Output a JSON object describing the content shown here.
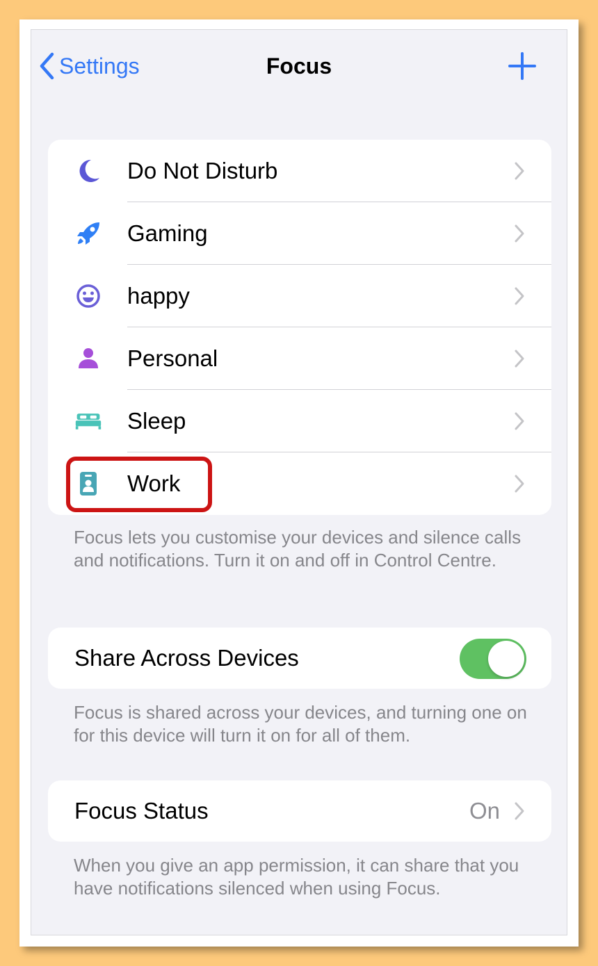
{
  "navbar": {
    "back_label": "Settings",
    "title": "Focus",
    "add_icon": "plus-icon"
  },
  "focus_modes": [
    {
      "label": "Do Not Disturb",
      "icon": "moon-icon",
      "color": "#5b57d6"
    },
    {
      "label": "Gaming",
      "icon": "rocket-icon",
      "color": "#2f7ff5"
    },
    {
      "label": "happy",
      "icon": "smiley-icon",
      "color": "#6a5fd7"
    },
    {
      "label": "Personal",
      "icon": "person-icon",
      "color": "#a64fd9"
    },
    {
      "label": "Sleep",
      "icon": "bed-icon",
      "color": "#49c3b8"
    },
    {
      "label": "Work",
      "icon": "id-badge-icon",
      "color": "#48a6b5"
    }
  ],
  "focus_footer": "Focus lets you customise your devices and silence calls and notifications. Turn it on and off in Control Centre.",
  "share": {
    "label": "Share Across Devices",
    "enabled": true,
    "footer": "Focus is shared across your devices, and turning one on for this device will turn it on for all of them."
  },
  "status": {
    "label": "Focus Status",
    "value": "On",
    "footer": "When you give an app permission, it can share that you have notifications silenced when using Focus."
  },
  "colors": {
    "accent": "#3478f6",
    "toggle_on": "#5fc162",
    "highlight": "#cc1414",
    "background": "#f2f2f7"
  }
}
